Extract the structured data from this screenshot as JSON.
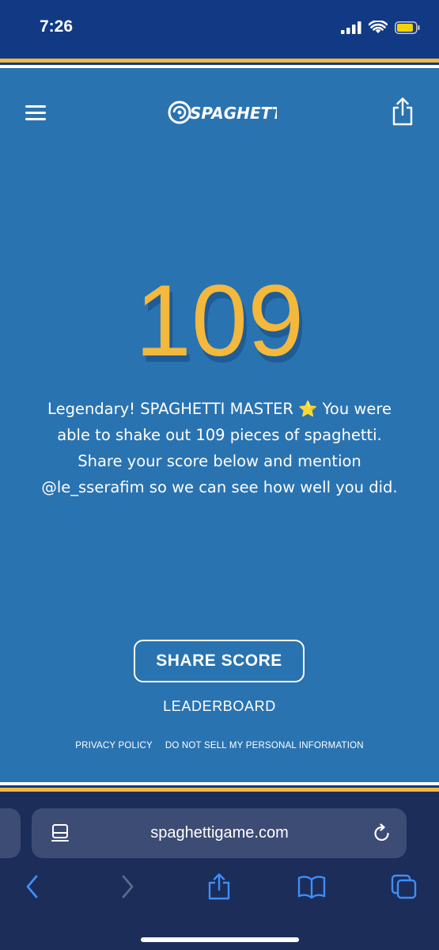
{
  "status_bar": {
    "time": "7:26"
  },
  "header": {
    "logo_text": "SPAGHETTI"
  },
  "result": {
    "score": "109",
    "message_lines": [
      "Legendary! SPAGHETTI MASTER ⭐ You were",
      "able to shake out 109 pieces of spaghetti.",
      "Share your score below and mention",
      "@le_sserafim so we can see how well you did."
    ]
  },
  "actions": {
    "share_score_label": "SHARE SCORE",
    "leaderboard_label": "LEADERBOARD"
  },
  "footer": {
    "privacy_label": "PRIVACY POLICY",
    "do_not_sell_label": "DO NOT SELL MY PERSONAL INFORMATION"
  },
  "browser": {
    "url": "spaghettigame.com",
    "toolbar_icons": [
      "back-icon",
      "forward-icon",
      "share-icon",
      "bookmarks-icon",
      "tabs-icon"
    ]
  },
  "colors": {
    "background": "#2a73b1",
    "score": "#f3b83c",
    "stripe_gold": "#f3b83c",
    "stripe_navy": "#123a84",
    "browser_bg": "#1c2d5a",
    "accent_blue": "#3e8ef7"
  }
}
